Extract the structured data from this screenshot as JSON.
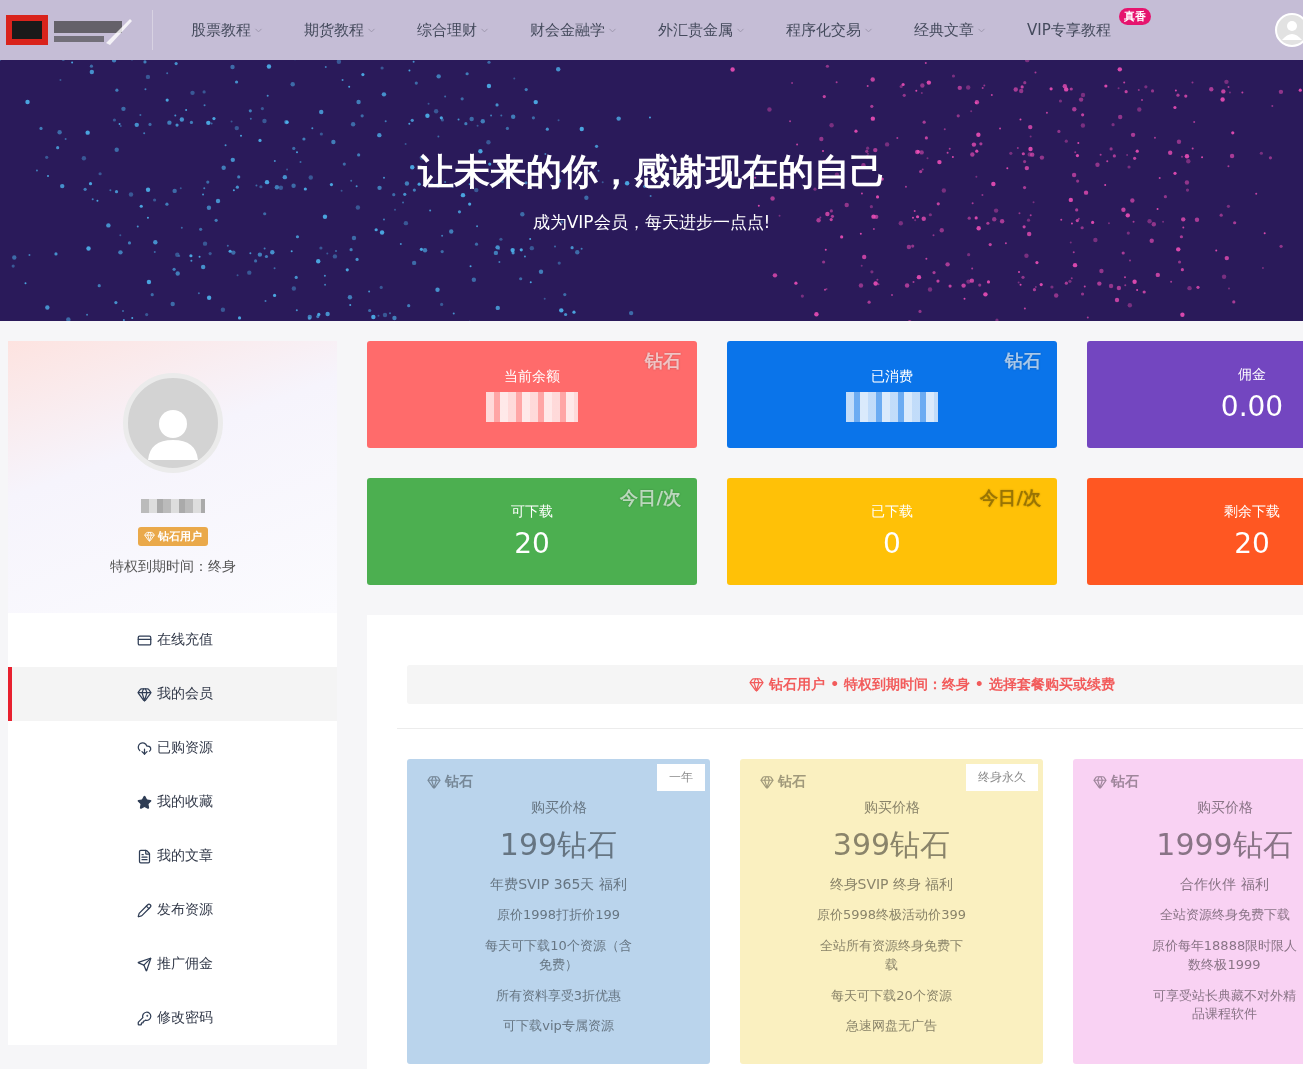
{
  "nav": {
    "items": [
      {
        "label": "股票教程",
        "dropdown": true
      },
      {
        "label": "期货教程",
        "dropdown": true
      },
      {
        "label": "综合理财",
        "dropdown": true
      },
      {
        "label": "财会金融学",
        "dropdown": true
      },
      {
        "label": "外汇贵金属",
        "dropdown": true
      },
      {
        "label": "程序化交易",
        "dropdown": true
      },
      {
        "label": "经典文章",
        "dropdown": true
      },
      {
        "label": "VIP专享教程",
        "dropdown": false,
        "badge": "真香"
      }
    ]
  },
  "banner": {
    "title": "让未来的你，感谢现在的自己",
    "subtitle": "成为VIP会员，每天进步一点点!"
  },
  "profile": {
    "badge": "钻石用户",
    "expiry": "特权到期时间：终身"
  },
  "sidebar": {
    "items": [
      {
        "label": "在线充值",
        "selected": false
      },
      {
        "label": "我的会员",
        "selected": true
      },
      {
        "label": "已购资源",
        "selected": false
      },
      {
        "label": "我的收藏",
        "selected": false
      },
      {
        "label": "我的文章",
        "selected": false
      },
      {
        "label": "发布资源",
        "selected": false
      },
      {
        "label": "推广佣金",
        "selected": false
      },
      {
        "label": "修改密码",
        "selected": false
      }
    ]
  },
  "stats": [
    {
      "label": "当前余额",
      "blurred": true,
      "tag": "钻石",
      "color": "#ff6b6b"
    },
    {
      "label": "已消费",
      "blurred": true,
      "tag": "钻石",
      "color": "#0a74ea"
    },
    {
      "label": "佣金",
      "value": "0.00",
      "blurred": false,
      "color": "#7346c0"
    },
    {
      "label": "可下载",
      "value": "20",
      "blurred": false,
      "tag": "今日/次",
      "color": "#4caf50"
    },
    {
      "label": "已下载",
      "value": "0",
      "blurred": false,
      "tag": "今日/次",
      "color": "#ffc107"
    },
    {
      "label": "剩余下载",
      "value": "20",
      "blurred": false,
      "color": "#ff5722"
    }
  ],
  "notice": "钻石用户 • 特权到期时间：终身 • 选择套餐购买或续费",
  "plans": [
    {
      "tag": "钻石",
      "period": "一年",
      "label": "购买价格",
      "price": "199钻石",
      "subtitle": "年费SVIP 365天 福利",
      "color": "#bad4ec",
      "features": [
        "原价1998打折价199",
        "每天可下载10个资源（含免费）",
        "所有资料享受3折优惠",
        "可下载vip专属资源"
      ]
    },
    {
      "tag": "钻石",
      "period": "终身永久",
      "label": "购买价格",
      "price": "399钻石",
      "subtitle": "终身SVIP 终身 福利",
      "color": "#faf0c0",
      "features": [
        "原价5998终极活动价399",
        "全站所有资源终身免费下载",
        "每天可下载20个资源",
        "急速网盘无广告"
      ]
    },
    {
      "tag": "钻石",
      "label": "购买价格",
      "price": "1999钻石",
      "subtitle": "合作伙伴 福利",
      "color": "#f9d2f3",
      "features": [
        "全站资源终身免费下载",
        "原价每年18888限时限人数终极1999",
        "可享受站长典藏不对外精品课程软件"
      ]
    }
  ]
}
